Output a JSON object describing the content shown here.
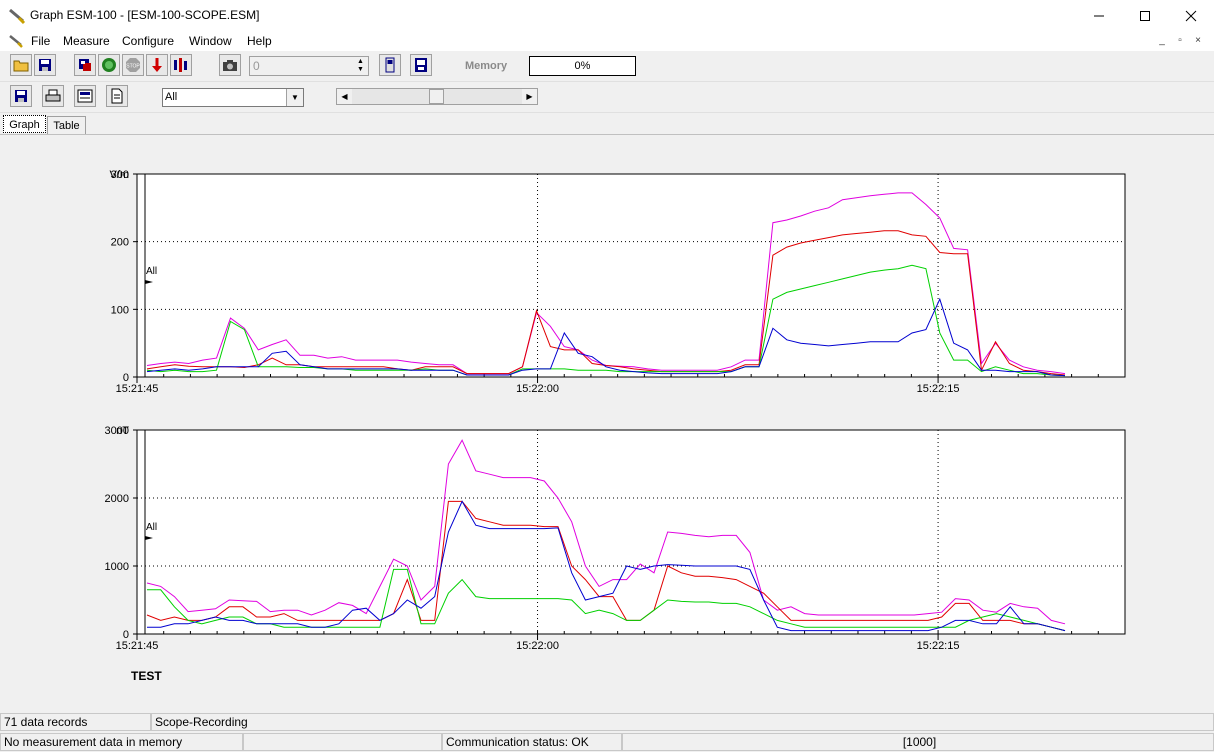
{
  "window": {
    "title": "Graph ESM-100 - [ESM-100-SCOPE.ESM]"
  },
  "menu": {
    "items": [
      "File",
      "Measure",
      "Configure",
      "Window",
      "Help"
    ]
  },
  "toolbar1": {
    "counter_value": "0",
    "memory_label": "Memory",
    "memory_value": "0%"
  },
  "toolbar2": {
    "channel_select": "All"
  },
  "tabs": {
    "graph": "Graph",
    "table": "Table"
  },
  "colors": {
    "magenta": "#e000e0",
    "red": "#e00000",
    "green": "#00d000",
    "blue": "#0000d0"
  },
  "charts": [
    {
      "unit": "V/m",
      "ylim": [
        0,
        300
      ],
      "yticks": [
        "0",
        "100",
        "200",
        "300"
      ],
      "xticks": [
        "15:21:45",
        "15:22:00",
        "15:22:15"
      ],
      "marker_label": "All",
      "chart_data": {
        "type": "line",
        "x_start_s": 0,
        "x_step_s": 1,
        "x_range_s": [
          0,
          37
        ],
        "series": [
          {
            "color": "magenta",
            "values": [
              17,
              20,
              22,
              20,
              25,
              28,
              87,
              72,
              40,
              48,
              55,
              32,
              32,
              28,
              30,
              25,
              25,
              25,
              25,
              22,
              20,
              18,
              18,
              5,
              5,
              5,
              5,
              15,
              95,
              75,
              45,
              40,
              25,
              17,
              16,
              15,
              12,
              10,
              10,
              10,
              10,
              10,
              15,
              25,
              25,
              228,
              232,
              238,
              245,
              250,
              262,
              265,
              268,
              270,
              272,
              272,
              255,
              235,
              190,
              188,
              20,
              50,
              25,
              15,
              10,
              8,
              5
            ]
          },
          {
            "color": "red",
            "values": [
              12,
              15,
              18,
              16,
              15,
              15,
              15,
              14,
              18,
              28,
              18,
              18,
              15,
              15,
              15,
              15,
              15,
              15,
              12,
              10,
              15,
              15,
              15,
              5,
              5,
              5,
              5,
              15,
              98,
              45,
              40,
              40,
              20,
              17,
              15,
              12,
              10,
              8,
              8,
              8,
              8,
              8,
              10,
              18,
              18,
              180,
              192,
              198,
              202,
              206,
              210,
              212,
              214,
              216,
              216,
              210,
              208,
              184,
              182,
              182,
              10,
              52,
              20,
              10,
              8,
              5,
              3
            ]
          },
          {
            "color": "green",
            "values": [
              10,
              8,
              10,
              8,
              8,
              10,
              82,
              70,
              15,
              15,
              15,
              14,
              14,
              12,
              12,
              10,
              10,
              10,
              10,
              10,
              12,
              10,
              10,
              3,
              3,
              3,
              3,
              12,
              12,
              12,
              12,
              10,
              10,
              10,
              8,
              8,
              8,
              8,
              8,
              8,
              8,
              8,
              8,
              15,
              15,
              115,
              125,
              130,
              135,
              140,
              145,
              150,
              155,
              158,
              160,
              165,
              160,
              65,
              25,
              25,
              8,
              15,
              10,
              5,
              5,
              3,
              2
            ]
          },
          {
            "color": "blue",
            "values": [
              8,
              10,
              12,
              10,
              12,
              15,
              15,
              15,
              15,
              35,
              38,
              18,
              15,
              12,
              12,
              12,
              12,
              12,
              12,
              10,
              10,
              10,
              10,
              3,
              3,
              3,
              3,
              10,
              12,
              12,
              65,
              35,
              30,
              15,
              10,
              8,
              6,
              5,
              5,
              5,
              5,
              5,
              8,
              15,
              15,
              72,
              55,
              50,
              48,
              46,
              48,
              50,
              52,
              52,
              52,
              65,
              70,
              115,
              50,
              40,
              10,
              10,
              8,
              8,
              8,
              3,
              2
            ]
          }
        ]
      }
    },
    {
      "unit": "nT",
      "ylim": [
        0,
        3000
      ],
      "yticks": [
        "0",
        "1000",
        "2000",
        "3000"
      ],
      "xticks": [
        "15:21:45",
        "15:22:00",
        "15:22:15"
      ],
      "marker_label": "All",
      "chart_data": {
        "type": "line",
        "x_start_s": 0,
        "x_step_s": 1,
        "x_range_s": [
          0,
          37
        ],
        "series": [
          {
            "color": "magenta",
            "values": [
              750,
              700,
              550,
              330,
              350,
              370,
              500,
              490,
              480,
              330,
              350,
              350,
              280,
              350,
              460,
              420,
              300,
              700,
              1100,
              1000,
              500,
              700,
              2500,
              2850,
              2400,
              2350,
              2300,
              2300,
              2300,
              2250,
              2000,
              1650,
              1000,
              700,
              800,
              800,
              1030,
              900,
              1500,
              1480,
              1450,
              1430,
              1450,
              1450,
              1200,
              500,
              350,
              400,
              300,
              280,
              280,
              280,
              280,
              280,
              280,
              280,
              280,
              300,
              320,
              520,
              500,
              350,
              320,
              450,
              400,
              380,
              200,
              150
            ]
          },
          {
            "color": "red",
            "values": [
              280,
              200,
              250,
              200,
              200,
              250,
              400,
              400,
              250,
              250,
              300,
              200,
              200,
              200,
              200,
              200,
              200,
              200,
              300,
              800,
              200,
              200,
              1950,
              1950,
              1700,
              1650,
              1600,
              1600,
              1600,
              1580,
              1580,
              1000,
              800,
              550,
              550,
              200,
              200,
              350,
              1000,
              900,
              850,
              850,
              830,
              800,
              700,
              600,
              400,
              200,
              200,
              200,
              200,
              200,
              200,
              200,
              200,
              200,
              200,
              200,
              250,
              450,
              450,
              200,
              200,
              200,
              150,
              150,
              100,
              50
            ]
          },
          {
            "color": "green",
            "values": [
              650,
              650,
              400,
              200,
              150,
              200,
              250,
              250,
              150,
              150,
              100,
              100,
              100,
              100,
              100,
              100,
              100,
              100,
              950,
              950,
              150,
              150,
              600,
              800,
              550,
              520,
              520,
              520,
              520,
              520,
              520,
              500,
              300,
              350,
              300,
              200,
              200,
              350,
              500,
              480,
              470,
              470,
              450,
              450,
              400,
              300,
              200,
              150,
              100,
              100,
              100,
              100,
              100,
              100,
              100,
              100,
              100,
              100,
              100,
              100,
              200,
              250,
              300,
              250,
              200,
              150,
              100,
              50
            ]
          },
          {
            "color": "blue",
            "values": [
              100,
              100,
              150,
              150,
              200,
              250,
              200,
              200,
              150,
              150,
              150,
              150,
              100,
              100,
              150,
              350,
              380,
              200,
              300,
              500,
              380,
              550,
              1500,
              1950,
              1600,
              1550,
              1550,
              1550,
              1550,
              1550,
              1560,
              900,
              500,
              550,
              600,
              1000,
              950,
              1000,
              1020,
              1010,
              1000,
              1000,
              1000,
              1000,
              950,
              500,
              100,
              50,
              50,
              50,
              50,
              50,
              50,
              50,
              50,
              50,
              50,
              50,
              100,
              200,
              200,
              150,
              150,
              400,
              150,
              150,
              100,
              50
            ]
          }
        ]
      }
    }
  ],
  "content": {
    "test_label": "TEST"
  },
  "status": {
    "records": "71 data records",
    "mode": "Scope-Recording",
    "memory_msg": "No measurement data in memory",
    "comm": "Communication status: OK",
    "count": "[1000]"
  }
}
